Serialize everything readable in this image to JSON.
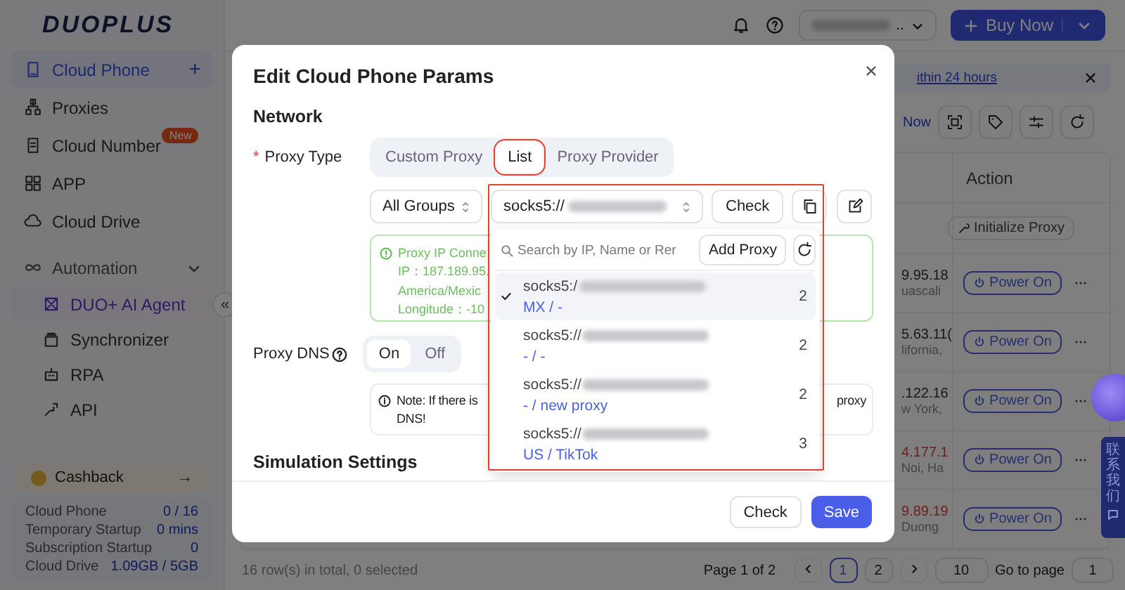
{
  "sidebar": {
    "logo": "DUOPLUS",
    "collapse": "«",
    "items": [
      {
        "label": "Cloud Phone",
        "selected": true,
        "action": "+"
      },
      {
        "label": "Proxies",
        "selected": false
      },
      {
        "label": "Cloud Number",
        "selected": false,
        "badge": "New"
      },
      {
        "label": "APP",
        "selected": false
      },
      {
        "label": "Cloud Drive",
        "selected": false
      }
    ],
    "group": {
      "label": "Automation",
      "expanded": true,
      "children": [
        {
          "label": "DUO+ AI Agent",
          "highlighted": true
        },
        {
          "label": "Synchronizer",
          "highlighted": false
        },
        {
          "label": "RPA",
          "highlighted": false
        },
        {
          "label": "API",
          "highlighted": false
        }
      ]
    },
    "cashback": {
      "label": "Cashback",
      "arrow": "→"
    },
    "usage": [
      {
        "label": "Cloud Phone",
        "value": "0 / 16"
      },
      {
        "label": "Temporary Startup",
        "value": "0 mins"
      },
      {
        "label": "Subscription Startup",
        "value": "0"
      },
      {
        "label": "Cloud Drive",
        "value": "1.09GB / 5GB"
      }
    ]
  },
  "header": {
    "account_suffix": "..",
    "buy_button": "Buy Now"
  },
  "banner": {
    "text": "ithin 24 hours"
  },
  "toolbar": {
    "link": "Now"
  },
  "table": {
    "columns": [
      "Action"
    ],
    "rows": [
      {
        "kind": "init",
        "action": "Initialize Proxy"
      },
      {
        "kind": "power",
        "ip": "9.95.18",
        "location": "uascali",
        "alert": false,
        "action": "Power On"
      },
      {
        "kind": "power",
        "ip": "5.63.11(",
        "location": "lifornia,",
        "alert": false,
        "action": "Power On"
      },
      {
        "kind": "power",
        "ip": ".122.16",
        "location": "w York,",
        "alert": false,
        "action": "Power On"
      },
      {
        "kind": "power",
        "ip": "4.177.1",
        "location": "Noi, Ha",
        "alert": true,
        "action": "Power On"
      },
      {
        "kind": "power",
        "ip": "9.89.19",
        "location": "Duong",
        "alert": true,
        "action": "Power On"
      }
    ]
  },
  "footer": {
    "summary": "16 row(s) in total, 0 selected",
    "page_info": "Page 1 of 2",
    "pages": [
      {
        "label": "1",
        "selected": true
      },
      {
        "label": "2",
        "selected": false
      }
    ],
    "page_size": "10",
    "goto_label": "Go to page",
    "goto_value": "1"
  },
  "contact": {
    "label": "联系我们"
  },
  "modal": {
    "title": "Edit Cloud Phone Params",
    "network_heading": "Network",
    "proxy_type": {
      "label": "Proxy Type",
      "required_mark": "*",
      "options": [
        {
          "label": "Custom Proxy",
          "selected": false
        },
        {
          "label": "List",
          "selected": true
        },
        {
          "label": "Proxy Provider",
          "selected": false
        }
      ]
    },
    "group_select": "All Groups",
    "proxy_select": "socks5://",
    "check_button": "Check",
    "status_lines": [
      "Proxy IP Conne",
      "IP：187.189.95.",
      "America/Mexic",
      "Longitude：-10"
    ],
    "proxy_dns": {
      "label": "Proxy DNS",
      "options": [
        {
          "label": "On",
          "selected": true
        },
        {
          "label": "Off",
          "selected": false
        }
      ]
    },
    "note": {
      "start": "Note: If there is",
      "end": "proxy",
      "second_line": "DNS!"
    },
    "simulation_heading": "Simulation Settings",
    "footer_buttons": [
      {
        "label": "Check",
        "kind": "default"
      },
      {
        "label": "Save",
        "kind": "primary"
      }
    ]
  },
  "dropdown": {
    "search_placeholder": "Search by IP, Name or Rer",
    "add_button": "Add Proxy",
    "items": [
      {
        "address": "socks5:/",
        "meta": "MX / -",
        "count": "2",
        "selected": true
      },
      {
        "address": "socks5://",
        "meta": "- / -",
        "count": "2",
        "selected": false
      },
      {
        "address": "socks5://",
        "meta": "- / new proxy",
        "count": "2",
        "selected": false
      },
      {
        "address": "socks5://",
        "meta": "US / TikTok",
        "count": "3",
        "selected": false
      }
    ]
  }
}
